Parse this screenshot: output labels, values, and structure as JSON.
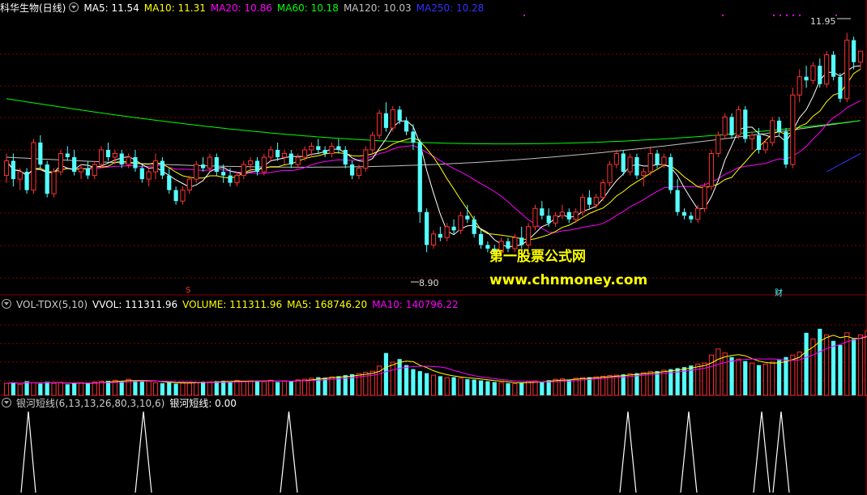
{
  "header_main": {
    "stock": "科华生物(日线)",
    "ma5": "MA5: 11.54",
    "ma10": "MA10: 11.31",
    "ma20": "MA20: 10.86",
    "ma60": "MA60: 10.18",
    "ma120": "MA120: 10.03",
    "ma250": "MA250: 10.28"
  },
  "header_vol": {
    "name": "VOL-TDX(5,10)",
    "vvol": "VVOL: 111311.96",
    "volume": "VOLUME: 111311.96",
    "ma5": "MA5: 168746.20",
    "ma10": "MA10: 140796.22"
  },
  "header_ind": {
    "name": "银河短线(6,13,13,26,80,3,10,6)",
    "value": "银河短线: 0.00"
  },
  "annotations": {
    "high": "11.95",
    "low": "8.90",
    "marker_s": "S",
    "marker_cai": "财"
  },
  "watermark": {
    "line1": "第一股票公式网",
    "line2": "www.chnmoney.com"
  },
  "colors": {
    "up": "#ff3232",
    "down": "#54ffff",
    "ma5": "#ffffff",
    "ma10": "#ffff00",
    "ma20": "#ff00ff",
    "ma60": "#00ff00",
    "ma120": "#c0c0c0",
    "ma250": "#3232ff",
    "grid": "#8b0000"
  },
  "chart_data": {
    "type": "candlestick",
    "ylim": [
      8.5,
      12.2
    ],
    "candles": [
      [
        10.0,
        10.3,
        9.9,
        10.2
      ],
      [
        10.2,
        10.3,
        9.85,
        9.95
      ],
      [
        9.95,
        10.1,
        9.8,
        10.05
      ],
      [
        10.05,
        10.1,
        9.75,
        9.8
      ],
      [
        9.8,
        10.5,
        9.75,
        10.45
      ],
      [
        10.45,
        10.55,
        10.1,
        10.15
      ],
      [
        10.15,
        10.2,
        9.7,
        9.75
      ],
      [
        9.75,
        10.1,
        9.7,
        10.05
      ],
      [
        10.05,
        10.35,
        10.0,
        10.3
      ],
      [
        10.3,
        10.4,
        10.2,
        10.25
      ],
      [
        10.25,
        10.35,
        10.0,
        10.05
      ],
      [
        10.05,
        10.15,
        9.95,
        10.1
      ],
      [
        10.1,
        10.2,
        9.95,
        10.0
      ],
      [
        10.0,
        10.2,
        9.95,
        10.15
      ],
      [
        10.15,
        10.4,
        10.1,
        10.35
      ],
      [
        10.35,
        10.45,
        10.2,
        10.25
      ],
      [
        10.25,
        10.35,
        10.15,
        10.3
      ],
      [
        10.3,
        10.35,
        10.1,
        10.15
      ],
      [
        10.15,
        10.3,
        10.1,
        10.25
      ],
      [
        10.25,
        10.35,
        10.05,
        10.1
      ],
      [
        10.1,
        10.15,
        9.9,
        9.95
      ],
      [
        9.95,
        10.1,
        9.85,
        10.05
      ],
      [
        10.05,
        10.3,
        9.95,
        10.2
      ],
      [
        10.2,
        10.25,
        9.95,
        10.0
      ],
      [
        10.0,
        10.1,
        9.75,
        9.8
      ],
      [
        9.8,
        9.85,
        9.6,
        9.65
      ],
      [
        9.65,
        9.85,
        9.6,
        9.8
      ],
      [
        9.8,
        10.0,
        9.75,
        9.95
      ],
      [
        9.95,
        10.2,
        9.9,
        10.15
      ],
      [
        10.15,
        10.25,
        10.05,
        10.1
      ],
      [
        10.1,
        10.3,
        10.05,
        10.25
      ],
      [
        10.25,
        10.3,
        10.0,
        10.05
      ],
      [
        10.05,
        10.15,
        9.9,
        10.0
      ],
      [
        10.0,
        10.1,
        9.85,
        9.9
      ],
      [
        9.9,
        10.05,
        9.85,
        10.0
      ],
      [
        10.0,
        10.2,
        9.95,
        10.15
      ],
      [
        10.15,
        10.25,
        10.05,
        10.2
      ],
      [
        10.2,
        10.25,
        10.0,
        10.05
      ],
      [
        10.05,
        10.3,
        10.0,
        10.25
      ],
      [
        10.25,
        10.4,
        10.2,
        10.35
      ],
      [
        10.35,
        10.45,
        10.2,
        10.25
      ],
      [
        10.25,
        10.35,
        10.15,
        10.3
      ],
      [
        10.3,
        10.35,
        10.1,
        10.15
      ],
      [
        10.15,
        10.3,
        10.1,
        10.25
      ],
      [
        10.25,
        10.4,
        10.2,
        10.35
      ],
      [
        10.35,
        10.45,
        10.25,
        10.4
      ],
      [
        10.4,
        10.5,
        10.3,
        10.35
      ],
      [
        10.35,
        10.4,
        10.25,
        10.3
      ],
      [
        10.3,
        10.45,
        10.25,
        10.4
      ],
      [
        10.4,
        10.5,
        10.3,
        10.35
      ],
      [
        10.35,
        10.4,
        10.1,
        10.15
      ],
      [
        10.15,
        10.2,
        9.95,
        10.0
      ],
      [
        10.0,
        10.15,
        9.95,
        10.1
      ],
      [
        10.1,
        10.4,
        10.05,
        10.35
      ],
      [
        10.35,
        10.6,
        10.3,
        10.55
      ],
      [
        10.55,
        10.9,
        10.5,
        10.85
      ],
      [
        10.85,
        11.0,
        10.6,
        10.65
      ],
      [
        10.65,
        10.95,
        10.6,
        10.9
      ],
      [
        10.9,
        10.95,
        10.7,
        10.75
      ],
      [
        10.75,
        10.8,
        10.55,
        10.6
      ],
      [
        10.6,
        10.7,
        10.35,
        10.45
      ],
      [
        10.45,
        10.5,
        9.35,
        9.5
      ],
      [
        9.5,
        9.55,
        8.95,
        9.05
      ],
      [
        9.05,
        9.25,
        9.0,
        9.2
      ],
      [
        9.2,
        9.3,
        9.1,
        9.15
      ],
      [
        9.15,
        9.35,
        9.1,
        9.3
      ],
      [
        9.3,
        9.4,
        9.2,
        9.25
      ],
      [
        9.25,
        9.5,
        9.2,
        9.45
      ],
      [
        9.45,
        9.6,
        9.35,
        9.4
      ],
      [
        9.4,
        9.45,
        9.15,
        9.2
      ],
      [
        9.2,
        9.25,
        9.0,
        9.05
      ],
      [
        9.05,
        9.1,
        8.95,
        9.0
      ],
      [
        9.0,
        9.05,
        8.9,
        8.95
      ],
      [
        8.95,
        9.15,
        8.9,
        9.1
      ],
      [
        9.1,
        9.15,
        8.95,
        9.0
      ],
      [
        9.0,
        9.2,
        8.95,
        9.15
      ],
      [
        9.15,
        9.3,
        9.0,
        9.05
      ],
      [
        9.05,
        9.35,
        9.0,
        9.3
      ],
      [
        9.3,
        9.6,
        9.25,
        9.55
      ],
      [
        9.55,
        9.65,
        9.4,
        9.45
      ],
      [
        9.45,
        9.55,
        9.3,
        9.35
      ],
      [
        9.35,
        9.5,
        9.3,
        9.45
      ],
      [
        9.45,
        9.6,
        9.4,
        9.5
      ],
      [
        9.5,
        9.55,
        9.35,
        9.4
      ],
      [
        9.4,
        9.55,
        9.35,
        9.5
      ],
      [
        9.5,
        9.75,
        9.45,
        9.7
      ],
      [
        9.7,
        9.8,
        9.55,
        9.6
      ],
      [
        9.6,
        9.75,
        9.55,
        9.7
      ],
      [
        9.7,
        9.95,
        9.65,
        9.9
      ],
      [
        9.9,
        10.2,
        9.85,
        10.15
      ],
      [
        10.15,
        10.35,
        10.1,
        10.3
      ],
      [
        10.3,
        10.35,
        10.0,
        10.05
      ],
      [
        10.05,
        10.3,
        10.0,
        10.25
      ],
      [
        10.25,
        10.3,
        9.95,
        10.0
      ],
      [
        10.0,
        10.1,
        9.85,
        10.05
      ],
      [
        10.05,
        10.4,
        10.0,
        10.3
      ],
      [
        10.3,
        10.35,
        10.1,
        10.15
      ],
      [
        10.15,
        10.3,
        10.1,
        10.25
      ],
      [
        10.25,
        10.3,
        9.75,
        9.8
      ],
      [
        9.8,
        9.95,
        9.45,
        9.5
      ],
      [
        9.5,
        9.55,
        9.4,
        9.45
      ],
      [
        9.45,
        9.5,
        9.35,
        9.4
      ],
      [
        9.4,
        9.6,
        9.35,
        9.55
      ],
      [
        9.55,
        9.9,
        9.5,
        9.85
      ],
      [
        9.85,
        10.35,
        9.8,
        10.3
      ],
      [
        10.3,
        10.6,
        10.25,
        10.55
      ],
      [
        10.55,
        10.85,
        10.5,
        10.8
      ],
      [
        10.8,
        10.85,
        10.5,
        10.55
      ],
      [
        10.55,
        10.95,
        10.5,
        10.9
      ],
      [
        10.9,
        10.95,
        10.45,
        10.5
      ],
      [
        10.5,
        10.6,
        10.35,
        10.55
      ],
      [
        10.55,
        10.65,
        10.3,
        10.35
      ],
      [
        10.35,
        10.5,
        10.3,
        10.45
      ],
      [
        10.45,
        10.8,
        10.4,
        10.75
      ],
      [
        10.75,
        10.8,
        10.55,
        10.6
      ],
      [
        10.6,
        10.65,
        10.1,
        10.15
      ],
      [
        10.15,
        11.2,
        10.1,
        11.1
      ],
      [
        11.1,
        11.45,
        11.0,
        11.35
      ],
      [
        11.35,
        11.5,
        11.2,
        11.3
      ],
      [
        11.3,
        11.55,
        11.25,
        11.5
      ],
      [
        11.5,
        11.6,
        11.2,
        11.25
      ],
      [
        11.25,
        11.7,
        11.2,
        11.65
      ],
      [
        11.65,
        11.7,
        11.3,
        11.35
      ],
      [
        11.35,
        11.4,
        11.0,
        11.05
      ],
      [
        11.05,
        11.95,
        11.0,
        11.85
      ],
      [
        11.85,
        11.9,
        11.45,
        11.55
      ],
      [
        11.55,
        11.7,
        11.45,
        11.7
      ]
    ],
    "volume_ylim": [
      0,
      450000
    ],
    "volumes": [
      60,
      65,
      55,
      70,
      62,
      58,
      67,
      60,
      64,
      55,
      61,
      63,
      58,
      66,
      70,
      72,
      75,
      68,
      80,
      73,
      71,
      69,
      62,
      60,
      65,
      58,
      63,
      61,
      64,
      68,
      66,
      70,
      72,
      67,
      74,
      69,
      71,
      73,
      68,
      75,
      66,
      72,
      69,
      77,
      80,
      85,
      90,
      88,
      92,
      95,
      100,
      105,
      108,
      115,
      120,
      145,
      210,
      165,
      180,
      150,
      130,
      120,
      110,
      100,
      95,
      88,
      90,
      85,
      80,
      78,
      74,
      70,
      66,
      63,
      60,
      58,
      64,
      70,
      72,
      68,
      75,
      80,
      82,
      78,
      85,
      88,
      90,
      92,
      95,
      98,
      100,
      104,
      107,
      110,
      113,
      118,
      120,
      125,
      130,
      135,
      140,
      148,
      155,
      160,
      200,
      230,
      210,
      190,
      180,
      170,
      160,
      150,
      155,
      165,
      175,
      190,
      200,
      215,
      310,
      280,
      330,
      300,
      270,
      250,
      310,
      280,
      300,
      320,
      260
    ],
    "indicator_ylim": [
      0,
      1
    ],
    "signals": [
      [
        0,
        34,
        1,
        36
      ],
      [
        1,
        175,
        1,
        179
      ],
      [
        2,
        354,
        1,
        359
      ],
      [
        3,
        773,
        1,
        777
      ],
      [
        4,
        848,
        1,
        852
      ],
      [
        5,
        938,
        1,
        942
      ],
      [
        6,
        962,
        1,
        966
      ]
    ]
  }
}
